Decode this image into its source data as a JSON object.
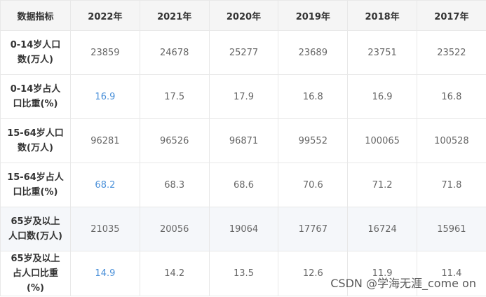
{
  "table": {
    "headers": [
      "数据指标",
      "2022年",
      "2021年",
      "2020年",
      "2019年",
      "2018年",
      "2017年"
    ],
    "rows": [
      {
        "label": "0-14岁人口数(万人)",
        "values": [
          "23859",
          "24678",
          "25277",
          "23689",
          "23751",
          "23522"
        ]
      },
      {
        "label": "0-14岁占人口比重(%)",
        "values": [
          "16.9",
          "17.5",
          "17.9",
          "16.8",
          "16.9",
          "16.8"
        ]
      },
      {
        "label": "15-64岁人口数(万人)",
        "values": [
          "96281",
          "96526",
          "96871",
          "99552",
          "100065",
          "100528"
        ]
      },
      {
        "label": "15-64岁占人口比重(%)",
        "values": [
          "68.2",
          "68.3",
          "68.6",
          "70.6",
          "71.2",
          "71.8"
        ]
      },
      {
        "label": "65岁及以上人口数(万人)",
        "values": [
          "21035",
          "20056",
          "19064",
          "17767",
          "16724",
          "15961"
        ]
      },
      {
        "label": "65岁及以上占人口比重(%)",
        "values": [
          "14.9",
          "14.2",
          "13.5",
          "12.6",
          "11.9",
          "11.4"
        ]
      }
    ]
  },
  "watermark": "CSDN @学海无涯_come on",
  "colors": {
    "highlight": "#4a90d9",
    "header_bg": "#f5f5f5",
    "shaded_row_bg": "#f5f7fa",
    "border": "#e8e8e8"
  }
}
